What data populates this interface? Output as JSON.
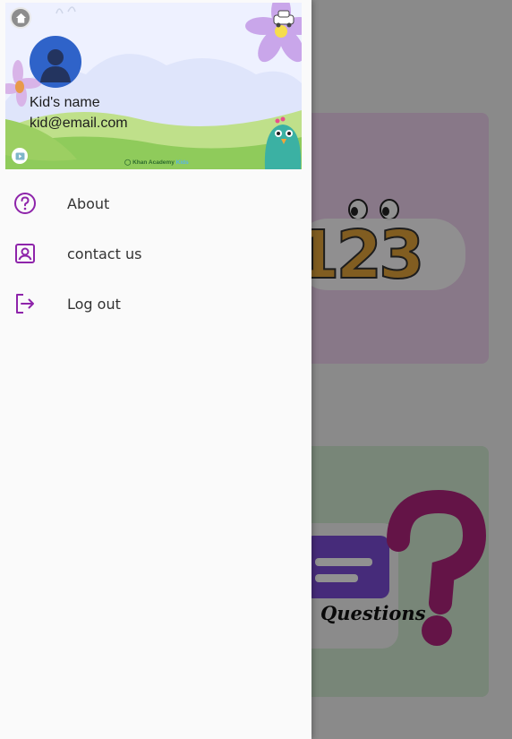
{
  "background": {
    "cards": [
      {
        "name": "numbers",
        "label": "123"
      },
      {
        "name": "questions",
        "label": "Questions"
      }
    ]
  },
  "drawer": {
    "header": {
      "kid_name": "Kid's name",
      "kid_email": "kid@email.com",
      "brand": "Khan Academy",
      "brand_suffix": "Kids"
    },
    "menu": [
      {
        "label": "About",
        "icon": "help-circle-icon"
      },
      {
        "label": "contact us",
        "icon": "contact-card-icon"
      },
      {
        "label": "Log out",
        "icon": "logout-icon"
      }
    ]
  },
  "colors": {
    "accent": "#8e24aa",
    "avatar": "#2f63c9",
    "scrim": "rgba(0,0,0,0.43)"
  }
}
